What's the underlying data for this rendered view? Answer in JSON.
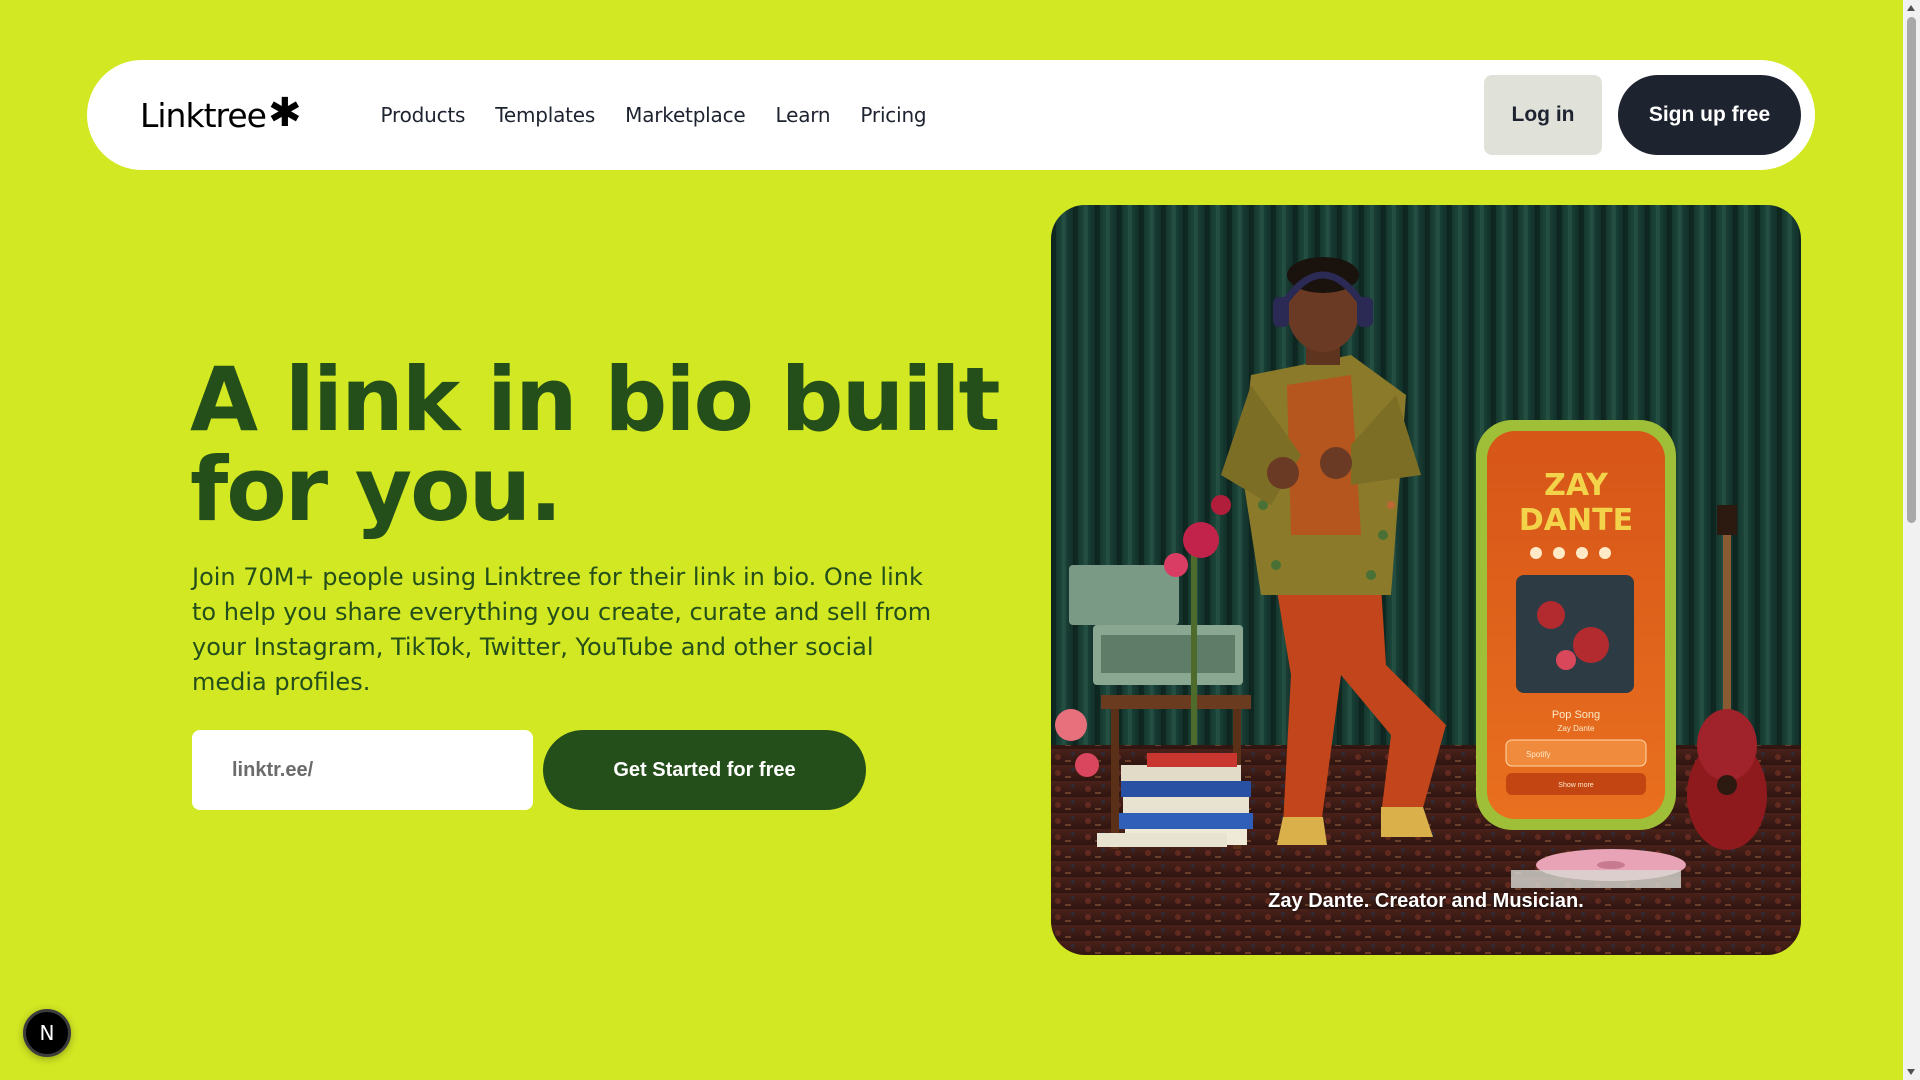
{
  "nav": {
    "logo_text": "Linktree",
    "logo_mark": "✱",
    "links": [
      "Products",
      "Templates",
      "Marketplace",
      "Learn",
      "Pricing"
    ],
    "login_label": "Log in",
    "signup_label": "Sign up free"
  },
  "hero": {
    "title": "A link in bio built for you.",
    "description": "Join 70M+ people using Linktree for their link in bio. One link to help you share everything you create, curate and sell from your Instagram, TikTok, Twitter, YouTube and other social media profiles.",
    "input_placeholder": "linktr.ee/",
    "cta_label": "Get Started for free",
    "image_caption": "Zay Dante. Creator and Musician.",
    "phone": {
      "name_line1": "ZAY",
      "name_line2": "DANTE",
      "song_title": "Pop Song",
      "song_artist": "Zay Dante",
      "link_label": "Spotify",
      "more_label": "Show more"
    }
  },
  "badge": {
    "icon": "next-n-icon",
    "letter": "N"
  },
  "colors": {
    "background": "#d2e823",
    "title": "#254f1a",
    "cta": "#254f1a",
    "signup": "#1e2330",
    "login": "#e0e2d9"
  }
}
